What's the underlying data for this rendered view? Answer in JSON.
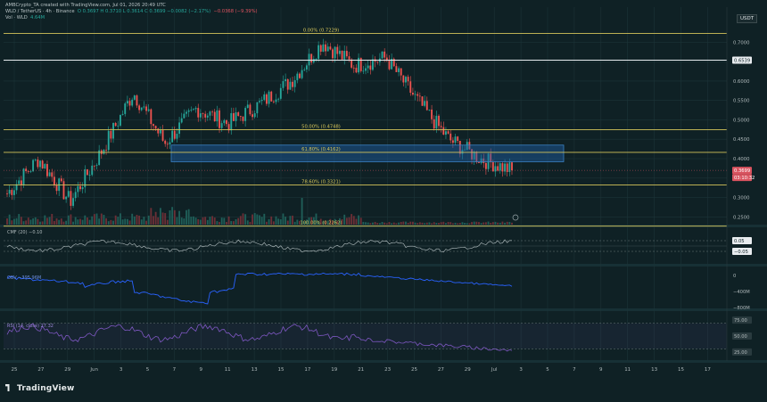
{
  "header": {
    "published": "AMBCrypto_TA created with TradingView.com, Jul 01, 2026 20:49 UTC",
    "symbol_line": "WLD / TetherUS · 4h · Binance",
    "ohlc": "O 0.3697  H 0.3710  L 0.3614  C 0.3699  −0.0082 (−2.17%)",
    "vol_line": "Vol · WLD",
    "vol_value": "4.64M",
    "change_text": "−0.0368 (−9.39%)"
  },
  "currency_button": "USDT",
  "brand": "TradingView",
  "fib_levels": [
    {
      "label": "0.00% (0.7229)",
      "price": 0.7229
    },
    {
      "label": "50.00% (0.4748)",
      "price": 0.4748
    },
    {
      "label": "61.80% (0.4162)",
      "price": 0.4162
    },
    {
      "label": "78.60% (0.3321)",
      "price": 0.3321
    },
    {
      "label": "100.00% (0.2262)",
      "price": 0.2262
    }
  ],
  "resistance_price": 0.6539,
  "resistance_label": "0.6539",
  "current_price_label": "0.3699",
  "countdown_label": "03:10:32",
  "price_axis": {
    "ticks": [
      "0.7000",
      "0.6500",
      "0.6000",
      "0.5500",
      "0.5000",
      "0.4500",
      "0.4000",
      "0.3500",
      "0.3000",
      "0.2500"
    ],
    "values": [
      0.7,
      0.65,
      0.6,
      0.55,
      0.5,
      0.45,
      0.4,
      0.35,
      0.3,
      0.25
    ]
  },
  "time_axis": [
    "25",
    "27",
    "29",
    "Jun",
    "3",
    "5",
    "7",
    "9",
    "11",
    "13",
    "15",
    "17",
    "19",
    "21",
    "23",
    "25",
    "27",
    "29",
    "Jul",
    "3",
    "5",
    "7",
    "9",
    "11",
    "13",
    "15",
    "17"
  ],
  "indicators": {
    "cmf": {
      "label": "CMF (20)",
      "value": "−0.10",
      "ticks": [
        "0.05",
        "−0.05"
      ]
    },
    "obv": {
      "label": "OBV",
      "value": "−395.96M",
      "ticks": [
        "0",
        "−400M",
        "−800M"
      ]
    },
    "rsi": {
      "label": "RSI (14, close)",
      "value": "27.32",
      "ticks": [
        "75.00",
        "50.00",
        "25.00"
      ]
    }
  },
  "colors": {
    "background": "#0f2125",
    "bull": "#26a69a",
    "bear": "#ef5350",
    "fib": "#d6c55a",
    "zone": "#1f5fa8",
    "obv": "#2962ff",
    "rsi": "#7e57c2"
  },
  "chart_data": {
    "type": "candlestick",
    "series_name": "WLD / TetherUS",
    "timeframe": "4h",
    "ylim": [
      0.23,
      0.74
    ],
    "first_open": 0.31,
    "key_points": [
      {
        "x": "May 25",
        "close": 0.31
      },
      {
        "x": "May 26",
        "close": 0.4
      },
      {
        "x": "May 28",
        "close": 0.29
      },
      {
        "x": "Jun 1",
        "close": 0.42
      },
      {
        "x": "Jun 3",
        "close": 0.57
      },
      {
        "x": "Jun 5",
        "close": 0.44
      },
      {
        "x": "Jun 7",
        "close": 0.53
      },
      {
        "x": "Jun 10",
        "close": 0.49
      },
      {
        "x": "Jun 13",
        "close": 0.54
      },
      {
        "x": "Jun 15",
        "close": 0.6
      },
      {
        "x": "Jun 17",
        "close": 0.7
      },
      {
        "x": "Jun 19",
        "close": 0.64
      },
      {
        "x": "Jun 22",
        "close": 0.66
      },
      {
        "x": "Jun 24",
        "close": 0.55
      },
      {
        "x": "Jun 27",
        "close": 0.45
      },
      {
        "x": "Jun 30",
        "close": 0.4
      },
      {
        "x": "Jul 1",
        "close": 0.3699
      }
    ]
  }
}
